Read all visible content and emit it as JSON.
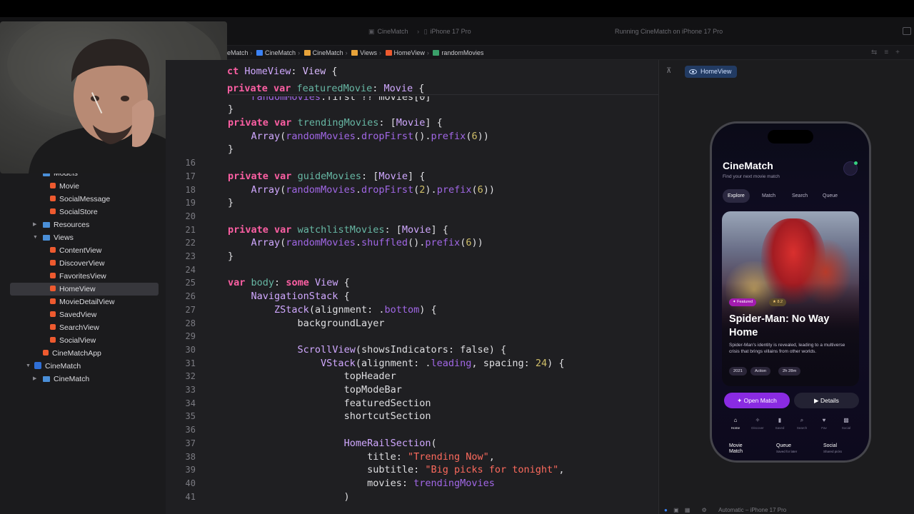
{
  "toolbar": {
    "scheme": "CineMatch",
    "device": "iPhone 17 Pro",
    "status": "Running CineMatch on iPhone 17 Pro"
  },
  "jumpbar": {
    "crumbs": [
      "CineMatch",
      "CineMatch",
      "CineMatch",
      "Views",
      "HomeView",
      "randomMovies"
    ],
    "first_crumb_clipped": "eMatch"
  },
  "navigator": {
    "items": [
      {
        "label": "Models",
        "kind": "folder"
      },
      {
        "label": "Movie",
        "kind": "file"
      },
      {
        "label": "SocialMessage",
        "kind": "file"
      },
      {
        "label": "SocialStore",
        "kind": "file"
      },
      {
        "label": "Resources",
        "kind": "folder"
      },
      {
        "label": "Views",
        "kind": "folder"
      },
      {
        "label": "ContentView",
        "kind": "file"
      },
      {
        "label": "DiscoverView",
        "kind": "file"
      },
      {
        "label": "FavoritesView",
        "kind": "file"
      },
      {
        "label": "HomeView",
        "kind": "file",
        "selected": true
      },
      {
        "label": "MovieDetailView",
        "kind": "file"
      },
      {
        "label": "SavedView",
        "kind": "file"
      },
      {
        "label": "SearchView",
        "kind": "file"
      },
      {
        "label": "SocialView",
        "kind": "file"
      },
      {
        "label": "CineMatchApp",
        "kind": "file"
      },
      {
        "label": "CineMatch",
        "kind": "project"
      },
      {
        "label": "CineMatch",
        "kind": "folder"
      }
    ]
  },
  "editor": {
    "sticky_lines": [
      "ct HomeView: View {",
      "private var featuredMovie: Movie {",
      "    randomMovies.first ?? movies[0]",
      "}"
    ],
    "lines": [
      {
        "n": "",
        "text": ""
      },
      {
        "n": "",
        "text": "private var trendingMovies: [Movie] {"
      },
      {
        "n": "",
        "text": "    Array(randomMovies.dropFirst().prefix(6))"
      },
      {
        "n": "",
        "text": "}"
      },
      {
        "n": "16",
        "text": ""
      },
      {
        "n": "17",
        "text": "private var guideMovies: [Movie] {"
      },
      {
        "n": "18",
        "text": "    Array(randomMovies.dropFirst(2).prefix(6))"
      },
      {
        "n": "19",
        "text": "}"
      },
      {
        "n": "20",
        "text": ""
      },
      {
        "n": "21",
        "text": "private var watchlistMovies: [Movie] {"
      },
      {
        "n": "22",
        "text": "    Array(randomMovies.shuffled().prefix(6))"
      },
      {
        "n": "23",
        "text": "}"
      },
      {
        "n": "24",
        "text": ""
      },
      {
        "n": "25",
        "text": "var body: some View {"
      },
      {
        "n": "26",
        "text": "    NavigationStack {"
      },
      {
        "n": "27",
        "text": "        ZStack(alignment: .bottom) {"
      },
      {
        "n": "28",
        "text": "            backgroundLayer"
      },
      {
        "n": "29",
        "text": ""
      },
      {
        "n": "30",
        "text": "            ScrollView(showsIndicators: false) {"
      },
      {
        "n": "31",
        "text": "                VStack(alignment: .leading, spacing: 24) {"
      },
      {
        "n": "32",
        "text": "                    topHeader"
      },
      {
        "n": "33",
        "text": "                    topModeBar"
      },
      {
        "n": "34",
        "text": "                    featuredSection"
      },
      {
        "n": "35",
        "text": "                    shortcutSection"
      },
      {
        "n": "36",
        "text": ""
      },
      {
        "n": "37",
        "text": "                    HomeRailSection("
      },
      {
        "n": "38",
        "text": "                        title: \"Trending Now\","
      },
      {
        "n": "39",
        "text": "                        subtitle: \"Big picks for tonight\","
      },
      {
        "n": "40",
        "text": "                        movies: trendingMovies"
      },
      {
        "n": "41",
        "text": "                    )"
      }
    ]
  },
  "canvas": {
    "preview_label": "HomeView",
    "bottom_device": "Automatic – iPhone 17 Pro"
  },
  "app": {
    "title": "CineMatch",
    "subtitle": "Find your next movie match",
    "modes": [
      "Explore",
      "Match",
      "Search",
      "Queue"
    ],
    "active_mode": "Explore",
    "featured": {
      "badge": "Featured",
      "rating": "8.2",
      "title": "Spider-Man: No Way Home",
      "description": "Spider-Man's identity is revealed, leading to a multiverse crisis that brings villains from other worlds.",
      "year": "2021",
      "genre": "Action",
      "runtime": "2h 28m"
    },
    "open_match": "Open Match",
    "details": "Details",
    "tabs": [
      {
        "label": "Home",
        "icon": "house-icon"
      },
      {
        "label": "Discover",
        "icon": "sparkles-icon"
      },
      {
        "label": "Saved",
        "icon": "bookmark-icon"
      },
      {
        "label": "Search",
        "icon": "magnifier-icon"
      },
      {
        "label": "Fav",
        "icon": "heart-icon"
      },
      {
        "label": "Social",
        "icon": "chat-bubbles-icon"
      }
    ],
    "shortcuts": [
      {
        "title": "Movie Match",
        "sub": ""
      },
      {
        "title": "Queue",
        "sub": "Saved for later"
      },
      {
        "title": "Social",
        "sub": "Shared picks"
      }
    ]
  }
}
